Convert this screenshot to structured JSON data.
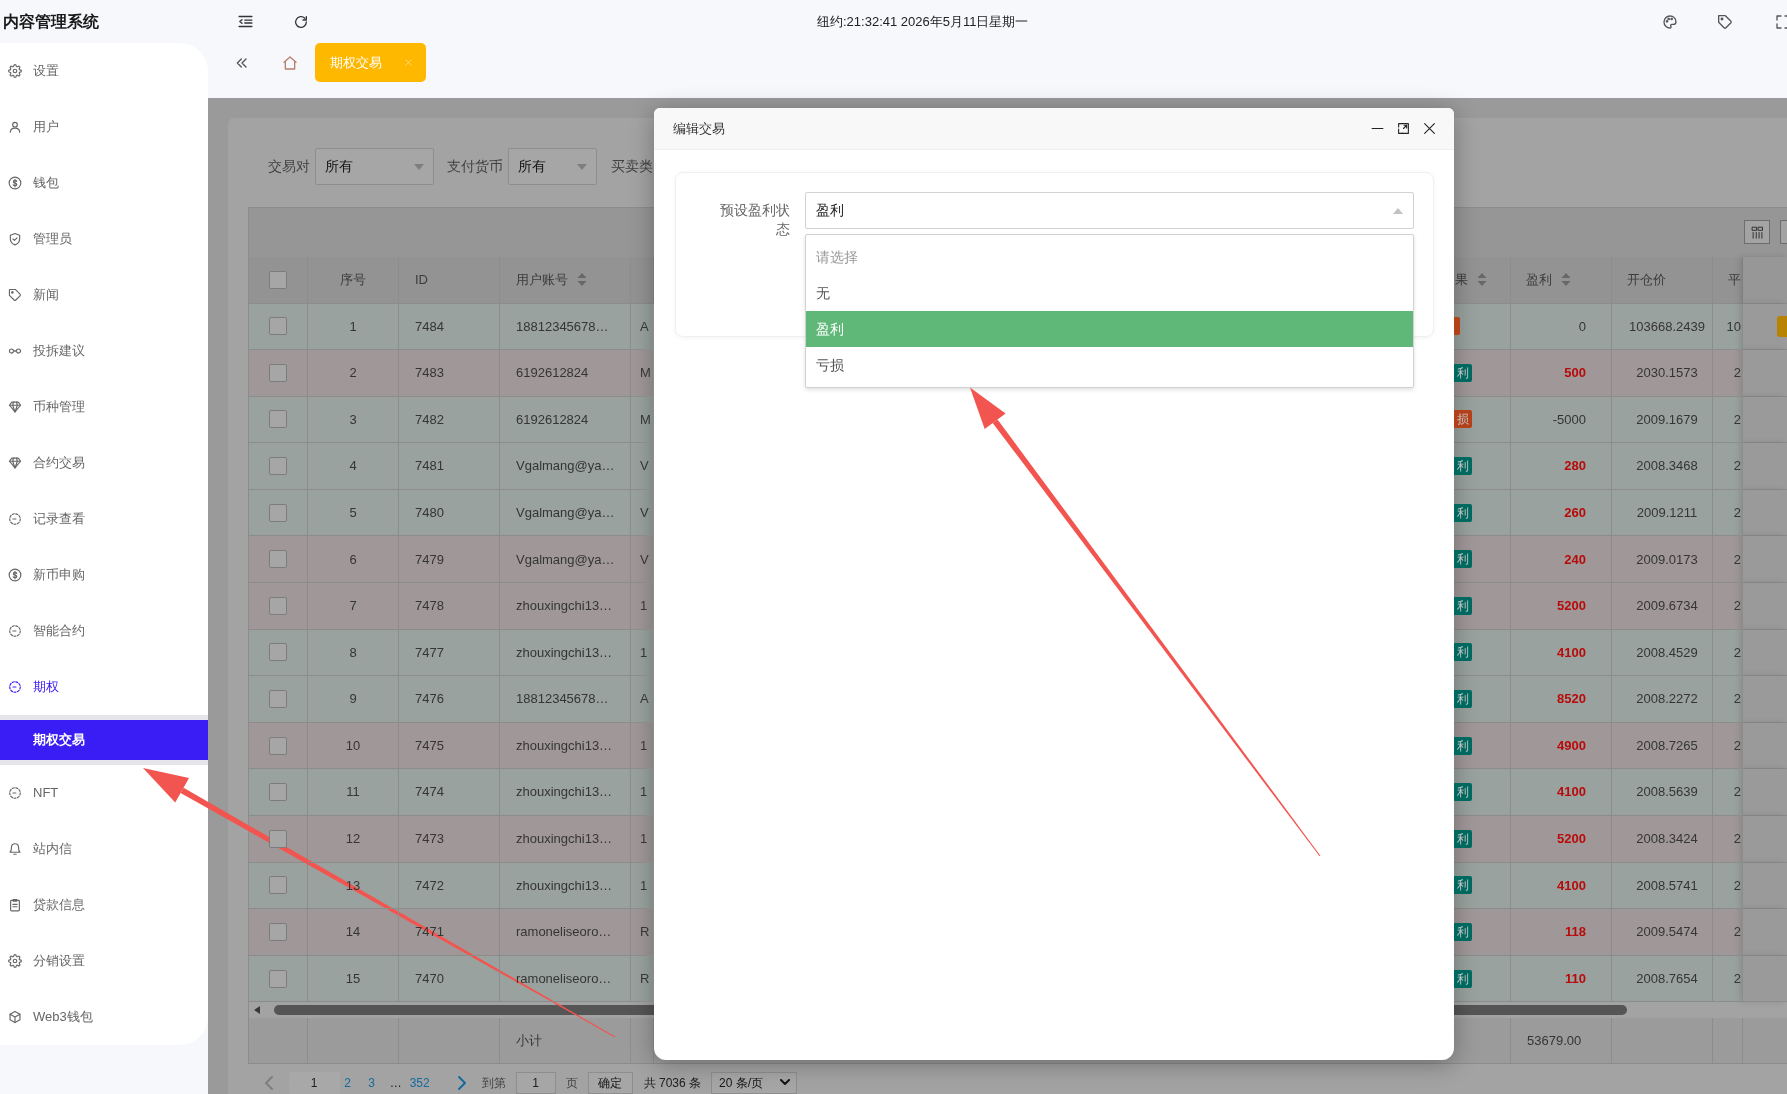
{
  "app": {
    "title": "内容管理系统",
    "clock": "纽约:21:32:41 2026年5月11日星期一"
  },
  "tabs": [
    {
      "label": "期权交易",
      "selected": true
    }
  ],
  "sidebar": {
    "items": [
      {
        "label": "设置",
        "selected": false,
        "expanded": false
      },
      {
        "label": "用户",
        "selected": false,
        "expanded": false
      },
      {
        "label": "钱包",
        "selected": false,
        "expanded": false
      },
      {
        "label": "管理员",
        "selected": false,
        "expanded": false
      },
      {
        "label": "新闻",
        "selected": false,
        "expanded": false
      },
      {
        "label": "投拆建议",
        "selected": false,
        "expanded": false
      },
      {
        "label": "币种管理",
        "selected": false,
        "expanded": false
      },
      {
        "label": "合约交易",
        "selected": false,
        "expanded": false
      },
      {
        "label": "记录查看",
        "selected": false,
        "expanded": false
      },
      {
        "label": "新币申购",
        "selected": false,
        "expanded": false
      },
      {
        "label": "智能合约",
        "selected": false,
        "expanded": false
      },
      {
        "label": "期权",
        "selected": false,
        "expanded": true,
        "children": [
          {
            "label": "期权交易",
            "selected": true
          }
        ]
      },
      {
        "label": "NFT",
        "selected": false,
        "expanded": false
      },
      {
        "label": "站内信",
        "selected": false,
        "expanded": false
      },
      {
        "label": "贷款信息",
        "selected": false,
        "expanded": false
      },
      {
        "label": "分销设置",
        "selected": false,
        "expanded": false
      },
      {
        "label": "Web3钱包",
        "selected": false,
        "expanded": false
      }
    ]
  },
  "filters": [
    {
      "label": "交易对",
      "value": "所有"
    },
    {
      "label": "支付货币",
      "value": "所有"
    },
    {
      "label": "买卖类"
    }
  ],
  "table": {
    "header_checkbox": {
      "checked": false
    },
    "columns": {
      "index": {
        "label": "序号",
        "sortable": false
      },
      "id": {
        "label": "ID",
        "sortable": false
      },
      "account": {
        "label": "用户账号",
        "sortable": true
      },
      "result": {
        "label": "果",
        "sortable": true
      },
      "profit": {
        "label": "盈利",
        "sortable": true
      },
      "open_price": {
        "label": "开仓价",
        "sortable": false
      },
      "column_10": {
        "label": "平",
        "sortable": false
      }
    },
    "rows": [
      {
        "checked": false,
        "color": "#99a29e",
        "index": "1",
        "id": "7484",
        "account": "18812345678…",
        "column_5": "A",
        "result_tag": {
          "color": "#b4401a"
        },
        "profit": "0",
        "profit_highlight": false,
        "open_price": "103668.2439",
        "column_10": "10",
        "action_badge": true
      },
      {
        "checked": false,
        "color": "#a09898",
        "index": "2",
        "id": "7483",
        "account": "6192612824",
        "column_5": "M",
        "result_tag": {
          "text": "利",
          "color": "#00695f"
        },
        "profit": "500",
        "profit_highlight": true,
        "open_price": "2030.1573",
        "column_10": "2",
        "action_badge": false
      },
      {
        "checked": false,
        "color": "#99a29e",
        "index": "3",
        "id": "7482",
        "account": "6192612824",
        "column_5": "M",
        "result_tag": {
          "text": "损",
          "color": "#b4401a"
        },
        "profit": "-5000",
        "profit_highlight": false,
        "open_price": "2009.1679",
        "column_10": "2",
        "action_badge": false
      },
      {
        "checked": false,
        "color": "#99a29e",
        "index": "4",
        "id": "7481",
        "account": "Vgalmang@ya…",
        "column_5": "V",
        "result_tag": {
          "text": "利",
          "color": "#00695f"
        },
        "profit": "280",
        "profit_highlight": true,
        "open_price": "2008.3468",
        "column_10": "2",
        "action_badge": false
      },
      {
        "checked": false,
        "color": "#99a29e",
        "index": "5",
        "id": "7480",
        "account": "Vgalmang@ya…",
        "column_5": "V",
        "result_tag": {
          "text": "利",
          "color": "#00695f"
        },
        "profit": "260",
        "profit_highlight": true,
        "open_price": "2009.1211",
        "column_10": "2",
        "action_badge": false
      },
      {
        "checked": false,
        "color": "#a09898",
        "index": "6",
        "id": "7479",
        "account": "Vgalmang@ya…",
        "column_5": "V",
        "result_tag": {
          "text": "利",
          "color": "#00695f"
        },
        "profit": "240",
        "profit_highlight": true,
        "open_price": "2009.0173",
        "column_10": "2",
        "action_badge": false
      },
      {
        "checked": false,
        "color": "#a09898",
        "index": "7",
        "id": "7478",
        "account": "zhouxingchi13…",
        "column_5": "1",
        "result_tag": {
          "text": "利",
          "color": "#00695f"
        },
        "profit": "5200",
        "profit_highlight": true,
        "open_price": "2009.6734",
        "column_10": "2",
        "action_badge": false
      },
      {
        "checked": false,
        "color": "#99a29e",
        "index": "8",
        "id": "7477",
        "account": "zhouxingchi13…",
        "column_5": "1",
        "result_tag": {
          "text": "利",
          "color": "#00695f"
        },
        "profit": "4100",
        "profit_highlight": true,
        "open_price": "2008.4529",
        "column_10": "2",
        "action_badge": false
      },
      {
        "checked": false,
        "color": "#99a29e",
        "index": "9",
        "id": "7476",
        "account": "18812345678…",
        "column_5": "A",
        "result_tag": {
          "text": "利",
          "color": "#00695f"
        },
        "profit": "8520",
        "profit_highlight": true,
        "open_price": "2008.2272",
        "column_10": "2",
        "action_badge": false
      },
      {
        "checked": false,
        "color": "#a09898",
        "index": "10",
        "id": "7475",
        "account": "zhouxingchi13…",
        "column_5": "1",
        "result_tag": {
          "text": "利",
          "color": "#00695f"
        },
        "profit": "4900",
        "profit_highlight": true,
        "open_price": "2008.7265",
        "column_10": "2",
        "action_badge": false
      },
      {
        "checked": false,
        "color": "#99a29e",
        "index": "11",
        "id": "7474",
        "account": "zhouxingchi13…",
        "column_5": "1",
        "result_tag": {
          "text": "利",
          "color": "#00695f"
        },
        "profit": "4100",
        "profit_highlight": true,
        "open_price": "2008.5639",
        "column_10": "2",
        "action_badge": false
      },
      {
        "checked": false,
        "color": "#a09898",
        "index": "12",
        "id": "7473",
        "account": "zhouxingchi13…",
        "column_5": "1",
        "result_tag": {
          "text": "利",
          "color": "#00695f"
        },
        "profit": "5200",
        "profit_highlight": true,
        "open_price": "2008.3424",
        "column_10": "2",
        "action_badge": false
      },
      {
        "checked": false,
        "color": "#99a29e",
        "index": "13",
        "id": "7472",
        "account": "zhouxingchi13…",
        "column_5": "1",
        "result_tag": {
          "text": "利",
          "color": "#00695f"
        },
        "profit": "4100",
        "profit_highlight": true,
        "open_price": "2008.5741",
        "column_10": "2",
        "action_badge": false
      },
      {
        "checked": false,
        "color": "#a09898",
        "index": "14",
        "id": "7471",
        "account": "ramoneliseoro…",
        "column_5": "R",
        "result_tag": {
          "text": "利",
          "color": "#00695f"
        },
        "profit": "118",
        "profit_highlight": true,
        "open_price": "2009.5474",
        "column_10": "2",
        "action_badge": false
      },
      {
        "checked": false,
        "color": "#99a29e",
        "index": "15",
        "id": "7470",
        "account": "ramoneliseoro…",
        "column_5": "R",
        "result_tag": {
          "text": "利",
          "color": "#00695f"
        },
        "profit": "110",
        "profit_highlight": true,
        "open_price": "2008.7654",
        "column_10": "2",
        "action_badge": false
      }
    ],
    "footer": {
      "label": "小计",
      "profit_total": "53679.00"
    }
  },
  "pagination": {
    "prev_disabled": true,
    "next_disabled": false,
    "pages": [
      {
        "label": "1",
        "kind": "page",
        "selected": true
      },
      {
        "label": "2",
        "kind": "page",
        "selected": false
      },
      {
        "label": "3",
        "kind": "page",
        "selected": false
      },
      {
        "label": "…",
        "kind": "ellipsis",
        "selected": false
      },
      {
        "label": "352",
        "kind": "page",
        "selected": false
      }
    ],
    "goto_label": "到第",
    "goto_value": "1",
    "goto_unit": "页",
    "confirm": "确定",
    "total": "共 7036 条",
    "page_size": "20 条/页"
  },
  "modal": {
    "title": "编辑交易",
    "fields": [
      {
        "label": "预设盈利状态",
        "value": "盈利",
        "open": true,
        "options": [
          {
            "label": "请选择",
            "kind": "placeholder",
            "selected": false
          },
          {
            "label": "无",
            "kind": "option",
            "selected": false
          },
          {
            "label": "盈利",
            "kind": "option",
            "selected": true
          },
          {
            "label": "亏损",
            "kind": "option",
            "selected": false
          }
        ]
      }
    ]
  },
  "annotations": [
    {
      "kind": "arrow"
    },
    {
      "kind": "arrow"
    }
  ]
}
